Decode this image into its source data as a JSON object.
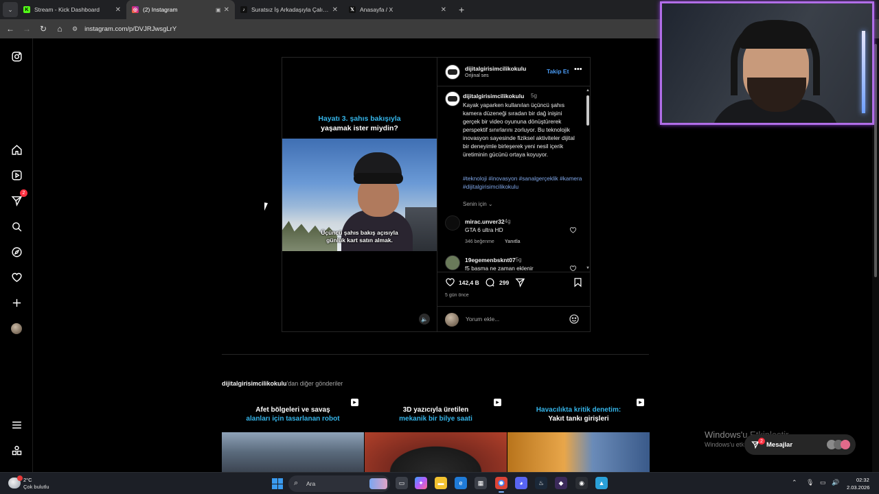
{
  "browser": {
    "tabs": [
      {
        "title": "Stream - Kick Dashboard",
        "favicon": "kick-icon",
        "color": "#53fc18"
      },
      {
        "title": "(2) Instagram",
        "favicon": "instagram-icon",
        "color": "#e1306c",
        "active": true
      },
      {
        "title": "Suratsız İş Arkadaşıyla Çalışmak",
        "favicon": "tiktok-icon",
        "color": "#000000"
      },
      {
        "title": "Anasayfa / X",
        "favicon": "x-icon",
        "color": "#000000"
      }
    ],
    "url": "instagram.com/p/DVJRJwsgLrY"
  },
  "instagram": {
    "nav_badge": "2",
    "post": {
      "media_headline_1": "Hayatı 3. şahıs bakışıyla",
      "media_headline_2": "yaşamak ister miydin?",
      "media_caption_1": "Üçüncü şahıs bakış açısıyla",
      "media_caption_2": "günlük kart satın almak.",
      "author": "dijitalgirisimcilikokulu",
      "audio": "Orijinal ses",
      "follow_label": "Takip Et",
      "caption_time": "5g",
      "caption_text": "Kayak yaparken kullanılan üçüncü şahıs kamera düzeneği sıradan bir dağ inişini gerçek bir video oyununa dönüştürerek perspektif sınırlarını zorluyor. Bu teknolojik inovasyon sayesinde fiziksel aktiviteler dijital bir deneyimle birleşerek yeni nesil içerik üretiminin gücünü ortaya koyuyor.",
      "hashtags": "#teknoloji #inovasyon #sanalgerçeklik #kamera #dijitalgirisimcilikokulu",
      "for_you": "Senin için",
      "comments": [
        {
          "user": "mirac.unver32",
          "time": "4g",
          "text": "GTA 6 ultra HD",
          "likes": "346 beğenme",
          "reply": "Yanıtla"
        },
        {
          "user": "19egemenbsknt07",
          "time": "5g",
          "text": "f5 basma ne zaman eklenir"
        }
      ],
      "like_count": "142,4 B",
      "comment_count": "299",
      "posted_ago": "5 gün önce",
      "comment_placeholder": "Yorum ekle..."
    },
    "more_from_user": "dijitalgirisimcilikokulu",
    "more_from_suffix": "'dan diğer gönderiler",
    "grid": [
      {
        "line1": "Afet bölgeleri ve savaş",
        "line2": "alanları için tasarlanan robot",
        "line1_color": "#ffffff",
        "line2_color": "#35b4e8"
      },
      {
        "line1": "3D yazıcıyla üretilen",
        "line2": "mekanik bir bilye saati",
        "line1_color": "#ffffff",
        "line2_color": "#35b4e8"
      },
      {
        "line1": "Havacılıkta kritik denetim:",
        "line2": "Yakıt tankı girişleri",
        "line1_color": "#35b4e8",
        "line2_color": "#ffffff"
      }
    ],
    "messages_label": "Mesajlar",
    "messages_badge": "2"
  },
  "windows": {
    "activate_title": "Windows'u Etkinleştir",
    "activate_sub": "Windows'u etkinleştirmek için Ayarlar'a gidin.",
    "weather_temp": "2°C",
    "weather_cond": "Çok bulutlu",
    "search_placeholder": "Ara",
    "time": "02:32",
    "date": "2.03.2026"
  }
}
